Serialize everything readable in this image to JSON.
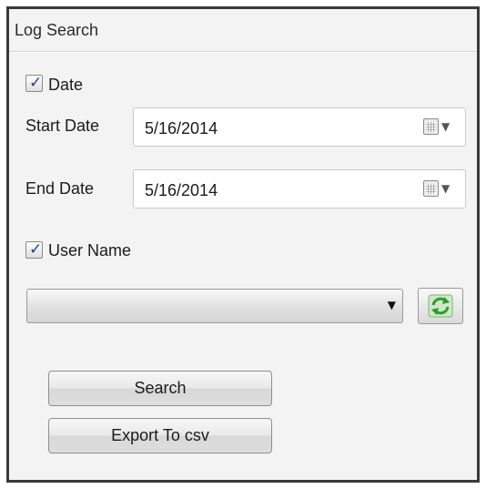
{
  "panel": {
    "title": "Log Search"
  },
  "date_filter": {
    "checkbox_label": "Date",
    "checked": true,
    "start_label": "Start Date",
    "start_value": "5/16/2014",
    "end_label": "End Date",
    "end_value": "5/16/2014"
  },
  "user_filter": {
    "checkbox_label": "User Name",
    "checked": true,
    "selected_value": ""
  },
  "buttons": {
    "search_label": "Search",
    "export_label": "Export To csv"
  },
  "icons": {
    "calendar": "calendar-icon",
    "dropdown": "chevron-down-icon",
    "refresh": "refresh-icon",
    "check": "check-icon"
  },
  "colors": {
    "panel_bg": "#f3f3f3",
    "border": "#3a3a3a",
    "checkmark": "#1f3f8c",
    "refresh_green": "#2e9a2e"
  }
}
